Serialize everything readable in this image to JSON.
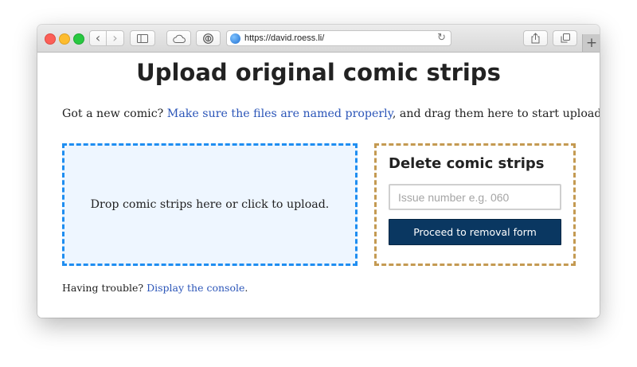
{
  "browser": {
    "url": "https://david.roess.li/",
    "back_glyph": "‹",
    "forward_glyph": "›",
    "reload_glyph": "↻",
    "new_tab_glyph": "+",
    "icons": [
      "back-icon",
      "forward-icon",
      "sidebar-icon",
      "icloud-tabs-icon",
      "password-manager-icon",
      "globe-icon",
      "reload-icon",
      "share-icon",
      "tabs-overview-icon",
      "new-tab-icon"
    ]
  },
  "page": {
    "title": "Upload original comic strips",
    "intro_prefix": "Got a new comic? ",
    "intro_link": "Make sure the files are named properly",
    "intro_suffix": ", and drag them here to start upload.",
    "dropzone_text": "Drop comic strips here or click to upload.",
    "trouble_prefix": "Having trouble? ",
    "trouble_link": "Display the console",
    "trouble_suffix": "."
  },
  "delete_panel": {
    "title": "Delete comic strips",
    "input_placeholder": "Issue number e.g. 060",
    "input_value": "",
    "button_label": "Proceed to removal form"
  },
  "colors": {
    "link": "#2b55b8",
    "dropzone_border": "#1f8ef1",
    "dropzone_bg": "#eef6ff",
    "delete_border": "#c49a52",
    "button_bg": "#0a3761"
  }
}
